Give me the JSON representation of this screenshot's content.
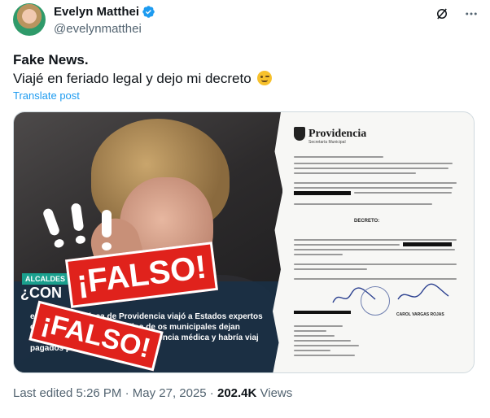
{
  "author": {
    "display_name": "Evelyn Matthei",
    "handle": "@evelynmatthei"
  },
  "icons": {
    "verified": "verified-badge-icon",
    "grok": "grok-icon",
    "more": "more-icon"
  },
  "tweet": {
    "title": "Fake News.",
    "body": "Viajé en feriado legal y dejo mi decreto",
    "emoji": "winking-face-emoji",
    "translate_label": "Translate post"
  },
  "media": {
    "photo": {
      "band_label": "ALCALDES EN",
      "band_title": "¿CON",
      "band_text": "entonces alcaldesa de Providencia viajó a Estados expertos en seguridad y orden público de os municipales dejan entrever os habría presentado licencia médica y habría viaj  pagados por la municipalidad",
      "stamp_large": "¡FALSO!",
      "stamp_small": "¡FALSO!"
    },
    "document": {
      "brand": "Providencia",
      "brand_sub": "Secretaría Municipal",
      "heading": "DECRETO:",
      "signer": "CAROL VARGAS ROJAS"
    }
  },
  "meta": {
    "last_edited": "Last edited 5:26 PM · May 27, 2025 · ",
    "views_count": "202.4K",
    "views_label": " Views"
  },
  "colors": {
    "accent": "#1d9bf0",
    "secondary_text": "#536471",
    "stamp_red": "#e0221c"
  }
}
